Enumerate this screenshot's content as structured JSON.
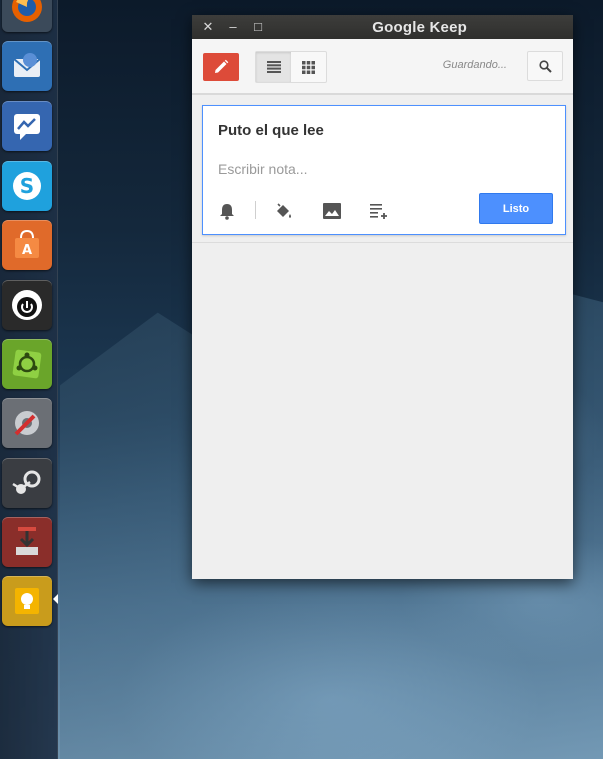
{
  "window": {
    "title": "Google Keep",
    "close_glyph": "✕",
    "minimize_glyph": "–",
    "maximize_glyph": "□"
  },
  "toolbar": {
    "new_note_icon": "pencil-icon",
    "list_view_icon": "list-view-icon",
    "grid_view_icon": "grid-view-icon",
    "status": "Guardando...",
    "search_icon": "search-icon"
  },
  "note": {
    "title": "Puto el que lee",
    "placeholder": "Escribir nota...",
    "icons": [
      "bell-icon",
      "paint-bucket-icon",
      "image-icon",
      "checklist-icon"
    ],
    "done_label": "Listo"
  },
  "launcher": {
    "items": [
      "firefox-icon",
      "thunderbird-icon",
      "messenger-icon",
      "skype-icon",
      "software-center-icon",
      "power-app-icon",
      "ubuntu-tweak-icon",
      "system-settings-icon",
      "steam-icon",
      "installer-icon",
      "google-keep-icon"
    ]
  },
  "colors": {
    "accent_red": "#dd4b39",
    "accent_blue": "#4d90fe",
    "keep_yellow": "#f4b400"
  }
}
